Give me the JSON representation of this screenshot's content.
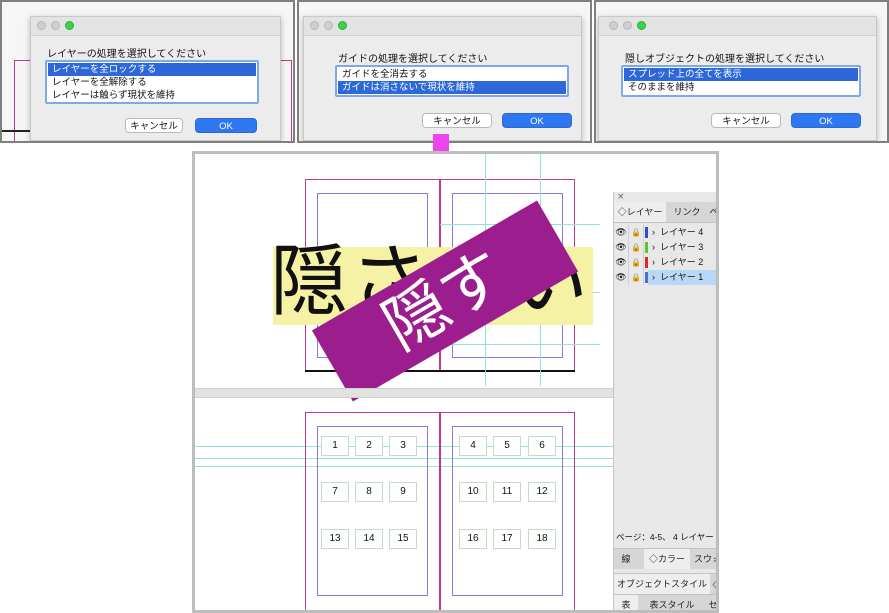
{
  "dialogs": [
    {
      "prompt": "レイヤーの処理を選択してください",
      "options": [
        "レイヤーを全ロックする",
        "レイヤーを全解除する",
        "レイヤーは触らず現状を維持"
      ],
      "selected_index": 0,
      "cancel_label": "キャンセル",
      "ok_label": "OK"
    },
    {
      "prompt": "ガイドの処理を選択してください",
      "options": [
        "ガイドを全消去する",
        "ガイドは消さないで現状を維持"
      ],
      "selected_index": 1,
      "cancel_label": "キャンセル",
      "ok_label": "OK"
    },
    {
      "prompt": "隠しオブジェクトの処理を選択してください",
      "options": [
        "スプレッド上の全てを表示",
        "そのままを維持"
      ],
      "selected_index": 0,
      "cancel_label": "キャンセル",
      "ok_label": "OK"
    }
  ],
  "colors": {
    "arrow": "#ee44ee",
    "banner": "#9b1d8e",
    "highlight": "#f5f1a5",
    "guide": "#8fe3e0",
    "page_border": "#c2398c",
    "selection": "#2e68d8"
  },
  "spread1": {
    "big_text": "隠さない",
    "banner_text": "隠す"
  },
  "spread2": {
    "left_numbers": [
      "1",
      "2",
      "3",
      "7",
      "8",
      "9",
      "13",
      "14",
      "15"
    ],
    "right_numbers": [
      "4",
      "5",
      "6",
      "10",
      "11",
      "12",
      "16",
      "17",
      "18"
    ]
  },
  "layers_panel": {
    "close_glyph": "×",
    "tabs": [
      "レイヤー",
      "リンク",
      "ペ"
    ],
    "tab_layers_prefix": "◇",
    "layers": [
      {
        "name": "レイヤー 4",
        "color": "#2d4bd8",
        "selected": false
      },
      {
        "name": "レイヤー 3",
        "color": "#52c832",
        "selected": false
      },
      {
        "name": "レイヤー 2",
        "color": "#d82828",
        "selected": false
      },
      {
        "name": "レイヤー 1",
        "color": "#4a6ee0",
        "selected": true
      }
    ],
    "status": "ページ：4-5、 4 レイヤー",
    "collapsed_tabs_row1": [
      "線",
      "◇カラー",
      "スウォ"
    ],
    "collapsed_tabs_row2": [
      "オブジェクトスタイル",
      "◇"
    ],
    "collapsed_tabs_row3": [
      "表",
      "表スタイル",
      "セ"
    ]
  }
}
